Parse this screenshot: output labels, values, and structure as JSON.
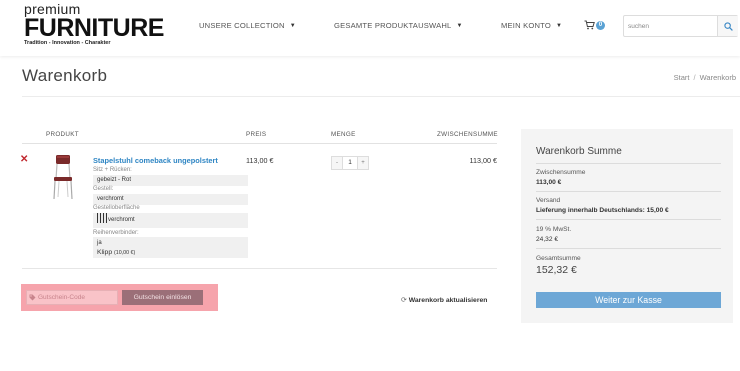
{
  "header": {
    "logo_line1": "premium",
    "logo_line2": "FURNITURE",
    "logo_tagline": "Tradition - Innovation - Charakter",
    "nav": [
      {
        "label": "UNSERE COLLECTION"
      },
      {
        "label": "GESAMTE PRODUKTAUSWAHL"
      },
      {
        "label": "MEIN KONTO"
      }
    ],
    "cart_count": "0",
    "search_placeholder": "suchen"
  },
  "page": {
    "title": "Warenkorb",
    "breadcrumb": [
      "Start",
      "Warenkorb"
    ]
  },
  "cart_table": {
    "headers": {
      "product": "PRODUKT",
      "price": "PREIS",
      "quantity": "MENGE",
      "subtotal": "ZWISCHENSUMME"
    },
    "item": {
      "name": "Stapelstuhl comeback ungepolstert",
      "options": [
        {
          "label": "Sitz + Rücken:",
          "value": "gebeizt - Rot"
        },
        {
          "label": "Gestell:",
          "value": "verchromt"
        },
        {
          "label": "Gestelloberfläche",
          "value": "verchromt"
        },
        {
          "label": "Reihenverbinder:",
          "value": "ja",
          "value2": "Klipp",
          "value2_note": "(10,00 €)"
        }
      ],
      "price": "113,00 €",
      "quantity": "1",
      "qty_minus": "-",
      "qty_plus": "+",
      "subtotal": "113,00 €"
    }
  },
  "coupon": {
    "placeholder": "Gutschein-Code",
    "button": "Gutschein einlösen"
  },
  "update_cart": "Warenkorb aktualisieren",
  "summary": {
    "title": "Warenkorb Summe",
    "subtotal_label": "Zwischensumme",
    "subtotal_value": "113,00 €",
    "shipping_label": "Versand",
    "shipping_value": "Lieferung innerhalb Deutschlands: 15,00 €",
    "tax_label": "19 % MwSt.",
    "tax_value": "24,32 €",
    "total_label": "Gesamtsumme",
    "total_value": "152,32 €",
    "checkout_button": "Weiter zur Kasse"
  },
  "colors": {
    "link_blue": "#2f86c4",
    "checkout_blue": "#6da7d6",
    "remove_red": "#c0262d",
    "highlight_pink": "#f6a4ac",
    "coupon_button": "#9b6f78"
  }
}
